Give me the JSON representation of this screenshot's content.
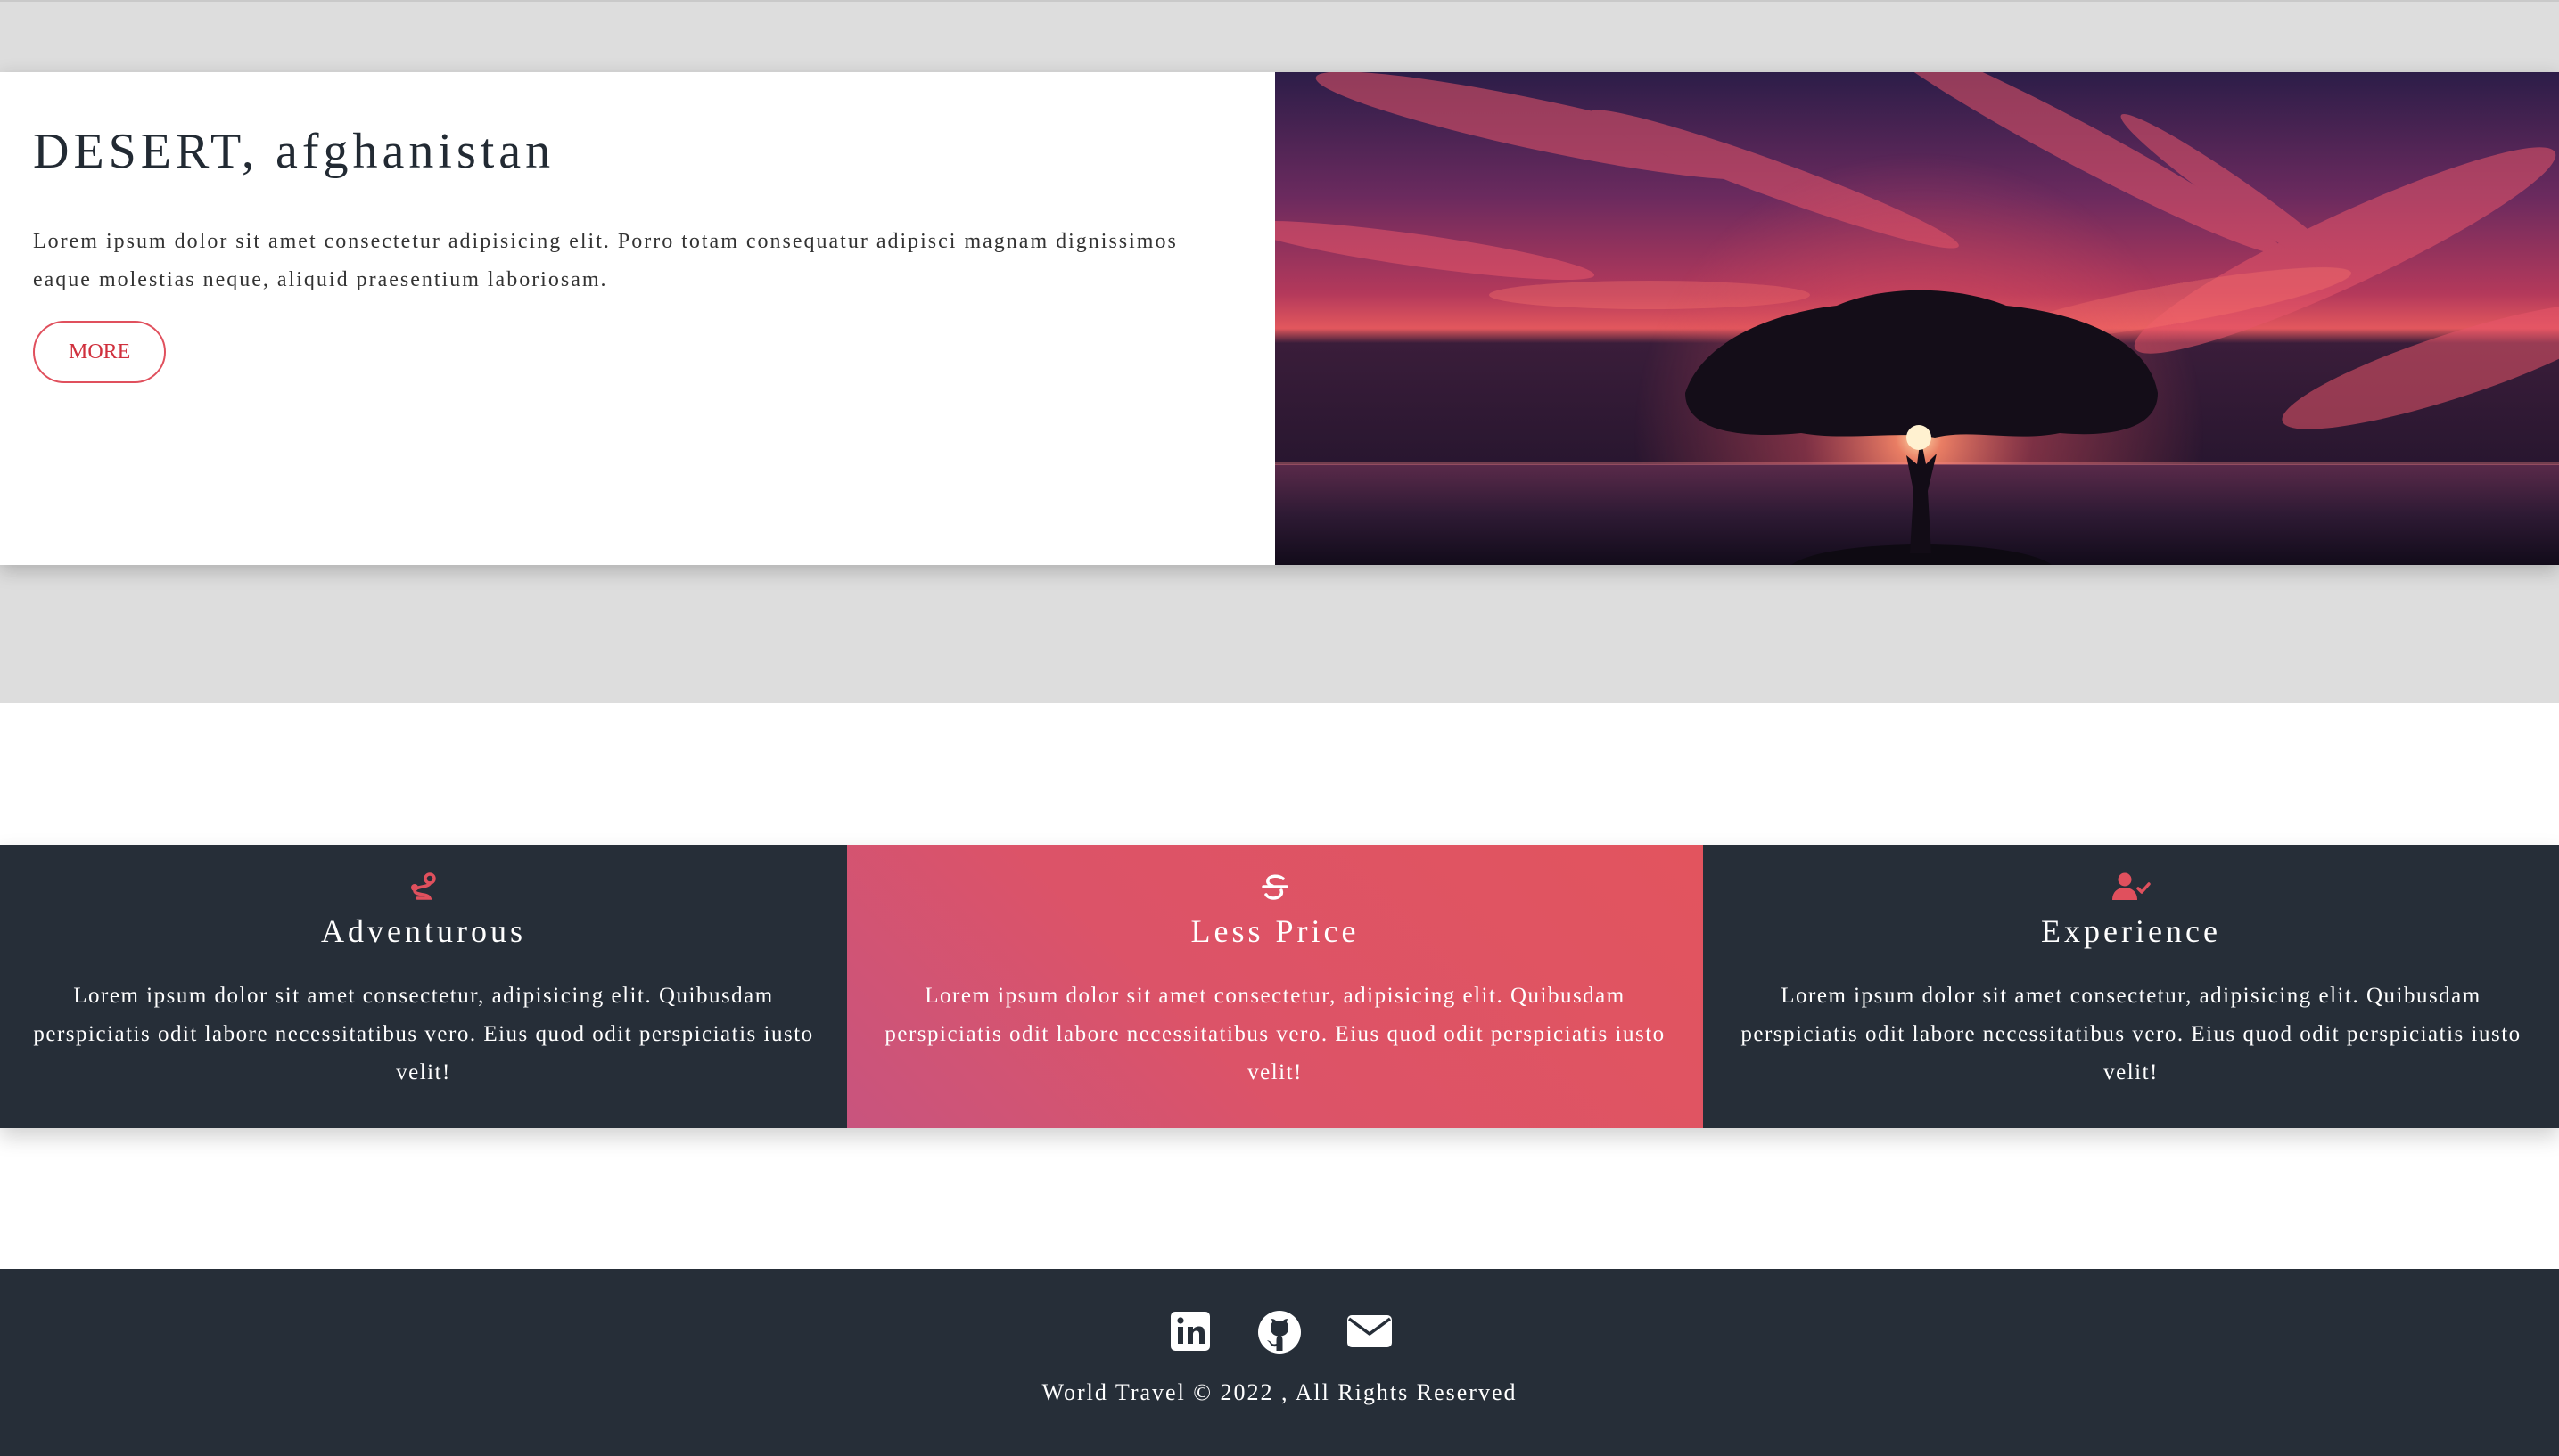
{
  "destination": {
    "title": "DESERT, afghanistan",
    "description": "Lorem ipsum dolor sit amet consectetur adipisicing elit. Porro totam consequatur adipisci magnam dignissimos eaque molestias neque, aliquid praesentium laboriosam.",
    "more_label": "MORE"
  },
  "features": [
    {
      "icon": "route-icon",
      "title": "Adventurous",
      "text": "Lorem ipsum dolor sit amet consectetur, adipisicing elit. Quibusdam perspiciatis odit labore necessitatibus vero. Eius quod odit perspiciatis iusto velit!"
    },
    {
      "icon": "strikethrough-s-icon",
      "title": "Less Price",
      "text": "Lorem ipsum dolor sit amet consectetur, adipisicing elit. Quibusdam perspiciatis odit labore necessitatibus vero. Eius quod odit perspiciatis iusto velit!"
    },
    {
      "icon": "user-check-icon",
      "title": "Experience",
      "text": "Lorem ipsum dolor sit amet consectetur, adipisicing elit. Quibusdam perspiciatis odit labore necessitatibus vero. Eius quod odit perspiciatis iusto velit!"
    }
  ],
  "footer": {
    "social": [
      "linkedin-icon",
      "github-icon",
      "envelope-icon"
    ],
    "copyright": "World Travel © 2022 , All Rights Reserved"
  },
  "colors": {
    "accent": "#e0505d",
    "dark": "#262e38",
    "page_bg": "#dddddd"
  }
}
